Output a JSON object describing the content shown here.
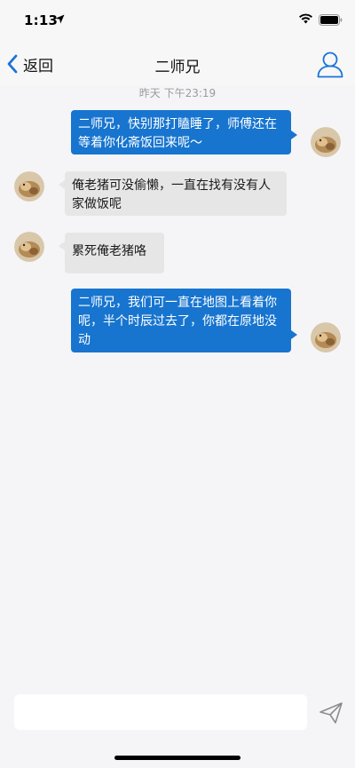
{
  "status_bar": {
    "time": "1:13"
  },
  "nav": {
    "back_label": "返回",
    "title": "二师兄"
  },
  "chat": {
    "timestamp": "昨天 下午23:19",
    "messages": [
      {
        "direction": "out",
        "text": "二师兄，快别那打瞌睡了，师傅还在等着你化斋饭回来呢～"
      },
      {
        "direction": "in",
        "text": "俺老猪可没偷懒，一直在找有没有人家做饭呢"
      },
      {
        "direction": "in",
        "text": "累死俺老猪咯"
      },
      {
        "direction": "out",
        "text": "二师兄，我们可一直在地图上看着你呢，半个时辰过去了，你都在原地没动"
      }
    ]
  },
  "input": {
    "value": "",
    "placeholder": ""
  },
  "colors": {
    "outgoing_bubble": "#1875cf",
    "incoming_bubble": "#e6e6e6",
    "accent": "#1a73d9"
  }
}
